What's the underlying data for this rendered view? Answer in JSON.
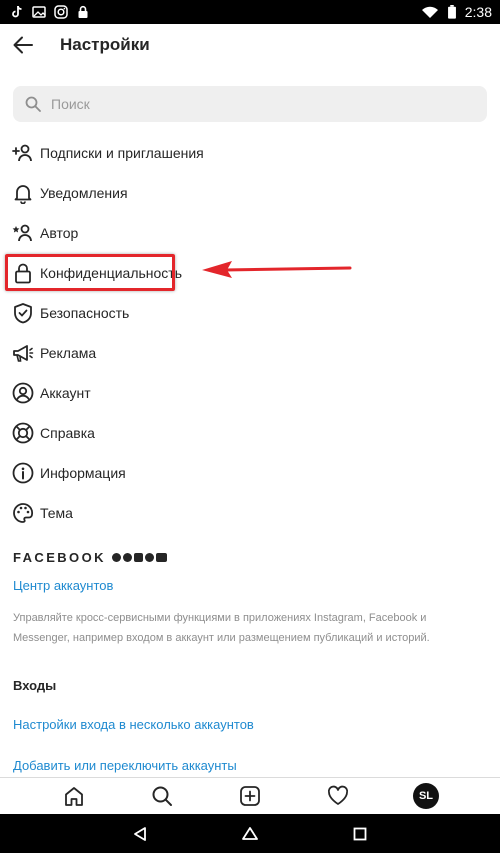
{
  "status_bar": {
    "time": "2:38",
    "left_icons": [
      "tiktok-icon",
      "image-icon",
      "instagram-icon",
      "lock-icon"
    ],
    "right_icons": [
      "wifi-icon",
      "battery-icon"
    ]
  },
  "header": {
    "title": "Настройки",
    "back_icon": "arrow-left-icon"
  },
  "search": {
    "placeholder": "Поиск",
    "value": ""
  },
  "menu": {
    "items": [
      {
        "label": "Подписки и приглашения",
        "icon": "add-person-icon"
      },
      {
        "label": "Уведомления",
        "icon": "bell-icon"
      },
      {
        "label": "Автор",
        "icon": "star-person-icon"
      },
      {
        "label": "Конфиденциальность",
        "icon": "lock-icon"
      },
      {
        "label": "Безопасность",
        "icon": "shield-icon"
      },
      {
        "label": "Реклама",
        "icon": "megaphone-icon"
      },
      {
        "label": "Аккаунт",
        "icon": "account-icon"
      },
      {
        "label": "Справка",
        "icon": "lifebuoy-icon"
      },
      {
        "label": "Информация",
        "icon": "info-icon"
      },
      {
        "label": "Тема",
        "icon": "palette-icon"
      }
    ]
  },
  "annotation": {
    "color": "#e3262b",
    "highlighted_item": "Конфиденциальность"
  },
  "facebook": {
    "brand": "FACEBOOK",
    "accounts_center": "Центр аккаунтов",
    "description": "Управляйте кросс-сервисными функциями в приложениях Instagram, Facebook и Messenger, например входом в аккаунт или размещением публикаций и историй."
  },
  "logins": {
    "title": "Входы",
    "multi_account": "Настройки входа в несколько аккаунтов",
    "add_switch": "Добавить или переключить аккаунты"
  },
  "bottom_nav": {
    "items": [
      "home-icon",
      "search-icon",
      "new-post-icon",
      "heart-icon",
      "profile-avatar"
    ],
    "avatar_initials": "SL"
  },
  "system_nav": {
    "items": [
      "back-triangle-icon",
      "home-circle-icon",
      "recents-square-icon"
    ]
  },
  "colors": {
    "link": "#1f8ad0",
    "text": "#262626",
    "muted": "#8e8e8e"
  }
}
